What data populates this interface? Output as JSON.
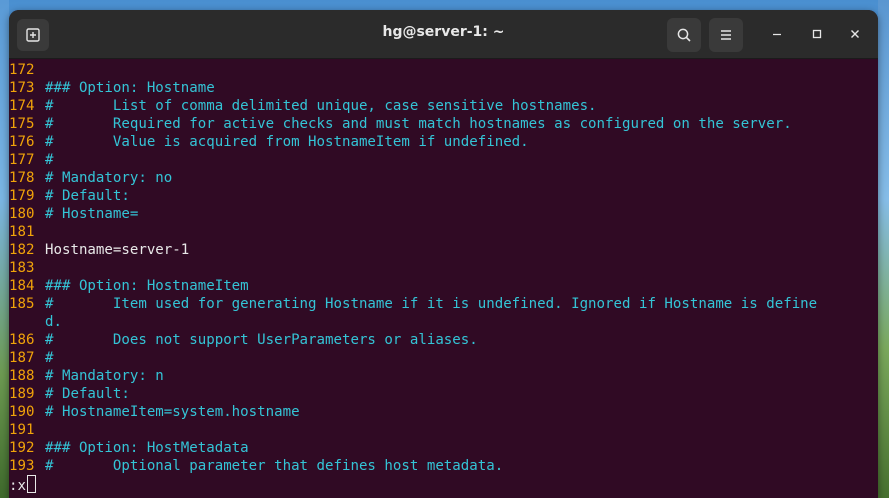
{
  "window": {
    "title": "hg@server-1: ~",
    "buttons": {
      "new_tab": "new-tab-icon",
      "search": "search-icon",
      "menu": "hamburger-menu-icon",
      "minimize": "minimize-icon",
      "maximize": "maximize-icon",
      "close": "close-icon"
    }
  },
  "colors": {
    "terminal_bg": "#300a24",
    "line_number": "#f0a30a",
    "comment": "#34c4d6",
    "text": "#e8e8e8"
  },
  "editor": {
    "lines": [
      {
        "num": "172",
        "text": "",
        "kind": "code"
      },
      {
        "num": "173",
        "text": "### Option: Hostname",
        "kind": "comment"
      },
      {
        "num": "174",
        "text": "#       List of comma delimited unique, case sensitive hostnames.",
        "kind": "comment"
      },
      {
        "num": "175",
        "text": "#       Required for active checks and must match hostnames as configured on the server.",
        "kind": "comment"
      },
      {
        "num": "176",
        "text": "#       Value is acquired from HostnameItem if undefined.",
        "kind": "comment"
      },
      {
        "num": "177",
        "text": "#",
        "kind": "comment"
      },
      {
        "num": "178",
        "text": "# Mandatory: no",
        "kind": "comment"
      },
      {
        "num": "179",
        "text": "# Default:",
        "kind": "comment"
      },
      {
        "num": "180",
        "text": "# Hostname=",
        "kind": "comment"
      },
      {
        "num": "181",
        "text": "",
        "kind": "code"
      },
      {
        "num": "182",
        "text": "Hostname=server-1",
        "kind": "code"
      },
      {
        "num": "183",
        "text": "",
        "kind": "code"
      },
      {
        "num": "184",
        "text": "### Option: HostnameItem",
        "kind": "comment"
      },
      {
        "num": "185",
        "text": "#       Item used for generating Hostname if it is undefined. Ignored if Hostname is define",
        "kind": "comment"
      },
      {
        "num": "",
        "text": "d.",
        "kind": "comment"
      },
      {
        "num": "186",
        "text": "#       Does not support UserParameters or aliases.",
        "kind": "comment"
      },
      {
        "num": "187",
        "text": "#",
        "kind": "comment"
      },
      {
        "num": "188",
        "text": "# Mandatory: n",
        "kind": "comment"
      },
      {
        "num": "189",
        "text": "# Default:",
        "kind": "comment"
      },
      {
        "num": "190",
        "text": "# HostnameItem=system.hostname",
        "kind": "comment"
      },
      {
        "num": "191",
        "text": "",
        "kind": "code"
      },
      {
        "num": "192",
        "text": "### Option: HostMetadata",
        "kind": "comment"
      },
      {
        "num": "193",
        "text": "#       Optional parameter that defines host metadata.",
        "kind": "comment"
      }
    ],
    "command_line": ":x"
  }
}
